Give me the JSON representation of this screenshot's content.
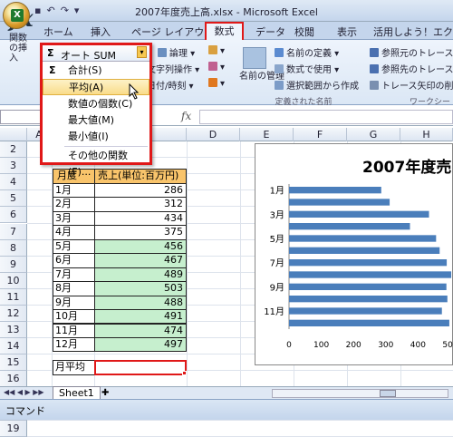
{
  "window": {
    "title": "2007年度売上高.xlsx - Microsoft Excel"
  },
  "tabs": [
    "ホーム",
    "挿入",
    "ページ レイアウト",
    "数式",
    "データ",
    "校閲",
    "表示",
    "活用しよう！エクセル"
  ],
  "ribbon": {
    "insert_function_label": "関数の挿入",
    "autosum_label": "オート SUM",
    "logic_label": "論理",
    "text_label": "文字列操作",
    "datetime_label": "日付/時刻",
    "define_name": "名前の定義",
    "use_in_formula": "数式で使用",
    "create_from_selection": "選択範囲から作成",
    "name_manager": "名前の管理",
    "defined_names_group": "定義された名前",
    "trace_precedents": "参照元のトレース",
    "trace_dependents": "参照先のトレース",
    "remove_arrows": "トレース矢印の削除",
    "workbook_group": "ワークシー"
  },
  "formula_bar": {
    "fx": "fx"
  },
  "autosum_menu": {
    "items": [
      "合計(S)",
      "平均(A)",
      "数値の個数(C)",
      "最大値(M)",
      "最小値(I)",
      "その他の関数(F)..."
    ]
  },
  "columns": [
    "A",
    "B",
    "C",
    "D",
    "E",
    "F",
    "G",
    "H"
  ],
  "rows": [
    "2",
    "3",
    "4",
    "5",
    "6",
    "7",
    "8",
    "9",
    "10",
    "11",
    "12",
    "13",
    "14",
    "15",
    "16",
    "17",
    "18",
    "19"
  ],
  "table": {
    "header_month": "月度",
    "header_sales": "売上(単位:百万円)",
    "months": [
      "1月",
      "2月",
      "3月",
      "4月",
      "5月",
      "6月",
      "7月",
      "8月",
      "9月",
      "10月",
      "11月",
      "12月"
    ],
    "values": [
      "286",
      "312",
      "434",
      "375",
      "456",
      "467",
      "489",
      "503",
      "488",
      "491",
      "474",
      "497"
    ],
    "avg_label": "月平均"
  },
  "chart_data": {
    "type": "bar",
    "title": "2007年度売",
    "categories": [
      "1月",
      "2月",
      "3月",
      "4月",
      "5月",
      "6月",
      "7月",
      "8月",
      "9月",
      "10月",
      "11月",
      "12月"
    ],
    "category_tick_labels": [
      "1月",
      "3月",
      "5月",
      "7月",
      "9月",
      "11月"
    ],
    "values": [
      286,
      312,
      434,
      375,
      456,
      467,
      489,
      503,
      488,
      491,
      474,
      497
    ],
    "x_ticks": [
      "0",
      "100",
      "200",
      "300",
      "400",
      "500"
    ],
    "xlim": [
      0,
      500
    ],
    "bar_color": "#4a7ebb",
    "grid": false
  },
  "sheet": {
    "tab": "Sheet1"
  },
  "status": {
    "mode": "コマンド"
  },
  "colors": {
    "highlight_red": "#e01818",
    "header_fill": "#f9c46b",
    "green_fill": "#c6efce"
  }
}
